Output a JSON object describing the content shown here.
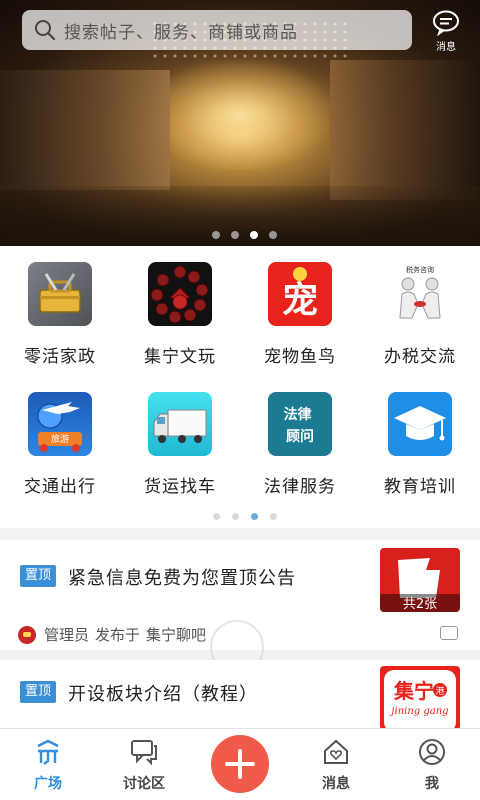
{
  "search": {
    "placeholder": "搜索帖子、服务、商铺或商品"
  },
  "header": {
    "messages_label": "消息"
  },
  "banner": {
    "dots": 4,
    "active_dot": 3
  },
  "categories": [
    {
      "label": "零活家政",
      "icon": "toolbox-icon"
    },
    {
      "label": "集宁文玩",
      "icon": "beads-icon"
    },
    {
      "label": "宠物鱼鸟",
      "icon": "pet-icon",
      "icon_text": "宠"
    },
    {
      "label": "办税交流",
      "icon": "tax-consult-icon",
      "icon_text": "税务咨询"
    },
    {
      "label": "交通出行",
      "icon": "travel-icon",
      "icon_text": "旅游"
    },
    {
      "label": "货运找车",
      "icon": "truck-icon"
    },
    {
      "label": "法律服务",
      "icon": "law-icon",
      "icon_text": "法律顾问"
    },
    {
      "label": "教育培训",
      "icon": "graduation-cap-icon"
    }
  ],
  "category_pager": {
    "dots": 4,
    "active_dot": 3
  },
  "posts": [
    {
      "tag": "置顶",
      "title": "紧急信息免费为您置顶公告",
      "thumb_caption": "共2张",
      "author": "管理员",
      "published_text": "发布于",
      "forum": "集宁聊吧"
    },
    {
      "tag": "置顶",
      "title": "开设板块介绍（教程）",
      "thumb_text": "集宁",
      "thumb_sub": "jining gang",
      "thumb_badge": "港"
    }
  ],
  "nav": {
    "plaza": "广场",
    "forum": "讨论区",
    "messages": "消息",
    "me": "我"
  },
  "colors": {
    "accent": "#2f8fe0",
    "fab": "#f05a4a",
    "tag": "#3b8fd7"
  }
}
